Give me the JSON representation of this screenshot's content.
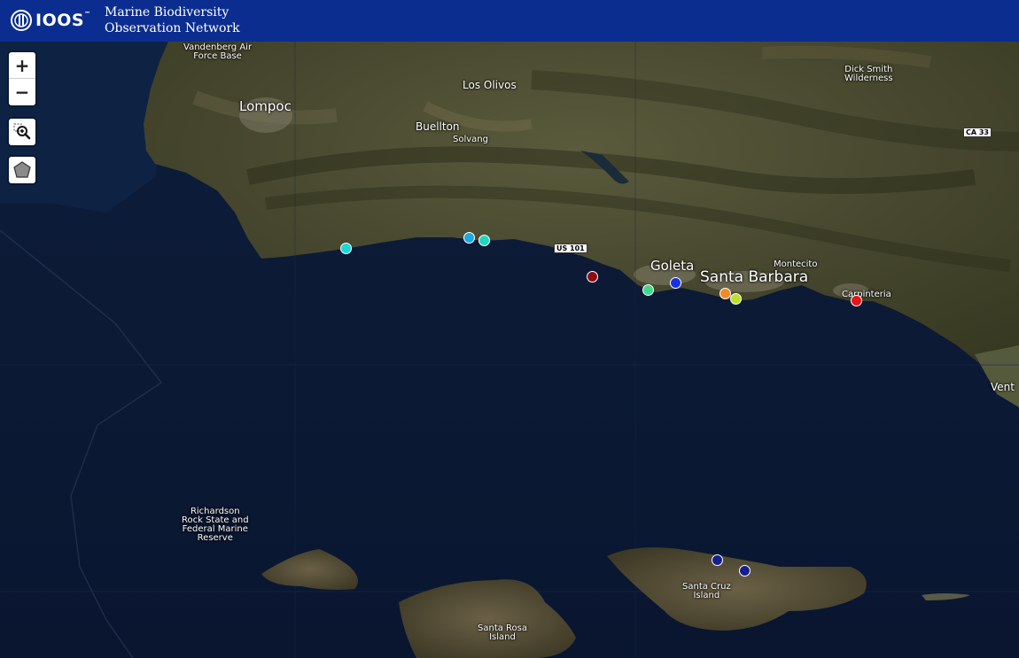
{
  "header": {
    "logo_text": "IOOS",
    "logo_tm": "™",
    "title_line1": "Marine Biodiversity",
    "title_line2": "Observation Network"
  },
  "controls": {
    "zoom_in": "+",
    "zoom_out": "−"
  },
  "places": {
    "vandenberg_1": "Vandenberg Air",
    "vandenberg_2": "Force Base",
    "lompoc": "Lompoc",
    "los_olivos": "Los Olivos",
    "buellton": "Buellton",
    "solvang": "Solvang",
    "dick_smith_1": "Dick Smith",
    "dick_smith_2": "Wilderness",
    "goleta": "Goleta",
    "santa_barbara": "Santa Barbara",
    "montecito": "Montecito",
    "carpinteria": "Carpinteria",
    "ventura": "Vent",
    "richardson_1": "Richardson",
    "richardson_2": "Rock State and",
    "richardson_3": "Federal Marine",
    "richardson_4": "Reserve",
    "santa_cruz_1": "Santa Cruz",
    "santa_cruz_2": "Island",
    "santa_rosa_1": "Santa Rosa",
    "santa_rosa_2": "Island"
  },
  "roads": {
    "us101": "US 101",
    "ca33": "CA 33"
  },
  "stations": [
    {
      "color": "#1fd6d6"
    },
    {
      "color": "#1aa9e0"
    },
    {
      "color": "#1fd6c0"
    },
    {
      "color": "#8b0d12"
    },
    {
      "color": "#3fd98a"
    },
    {
      "color": "#1630e6"
    },
    {
      "color": "#f08a24"
    },
    {
      "color": "#bde02a"
    },
    {
      "color": "#e8141b"
    },
    {
      "color": "#16208c"
    },
    {
      "color": "#16208c"
    }
  ]
}
